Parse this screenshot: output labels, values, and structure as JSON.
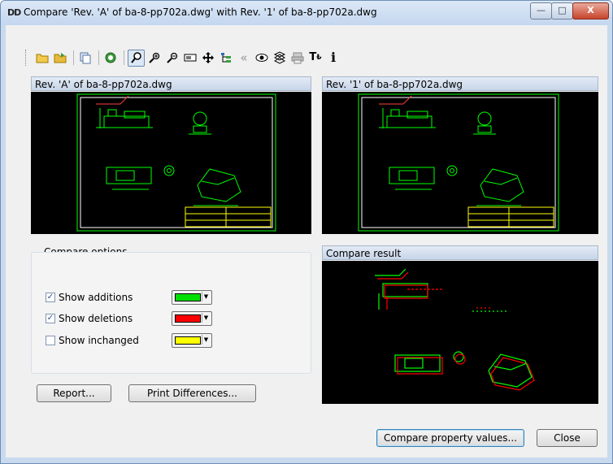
{
  "window": {
    "title": "Compare 'Rev. 'A' of ba-8-pp702a.dwg' with Rev. '1' of ba-8-pp702a.dwg",
    "icon_glyph": "DD",
    "controls": {
      "minimize": "—",
      "maximize": "□",
      "close": "X"
    }
  },
  "toolbar": {
    "buttons": [
      {
        "icon": "open-folder-icon",
        "glyph": "📂"
      },
      {
        "icon": "open-folder-alt-icon",
        "glyph": "📁"
      },
      {
        "icon": "copy-icon",
        "glyph": "⧉"
      },
      {
        "icon": "refresh-icon",
        "glyph": "⟳"
      },
      {
        "icon": "zoom-icon",
        "glyph": "🔍",
        "selected": true
      },
      {
        "icon": "zoom-in-icon",
        "glyph": "✚"
      },
      {
        "icon": "zoom-out-icon",
        "glyph": "▬"
      },
      {
        "icon": "zoom-window-icon",
        "glyph": "▭"
      },
      {
        "icon": "pan-icon",
        "glyph": "✥"
      },
      {
        "icon": "tree-icon",
        "glyph": "☰"
      },
      {
        "icon": "rewind-icon",
        "glyph": "«"
      },
      {
        "icon": "visibility-icon",
        "glyph": "◉"
      },
      {
        "icon": "layers-icon",
        "glyph": "≋"
      },
      {
        "icon": "print-icon",
        "glyph": "▤"
      },
      {
        "icon": "text-style-icon",
        "glyph": "Tᵦ"
      },
      {
        "icon": "info-icon",
        "glyph": "i"
      }
    ]
  },
  "left_panel": {
    "title": "Rev. 'A' of ba-8-pp702a.dwg"
  },
  "right_panel": {
    "title": "Rev. '1' of ba-8-pp702a.dwg"
  },
  "result_panel": {
    "title": "Compare result"
  },
  "options": {
    "group_title": "Compare options",
    "items": [
      {
        "label": "Show additions",
        "checked": true,
        "color": "#00e000"
      },
      {
        "label": "Show deletions",
        "checked": true,
        "color": "#ff0000"
      },
      {
        "label": "Show inchanged",
        "checked": false,
        "color": "#ffff00"
      }
    ]
  },
  "buttons": {
    "report": "Report...",
    "print_differences": "Print Differences...",
    "compare_property_values": "Compare property values...",
    "close": "Close"
  },
  "colors": {
    "drawing_lines": "#00ff00",
    "frame": "#ffffff",
    "title_frame": "#ffff00"
  }
}
